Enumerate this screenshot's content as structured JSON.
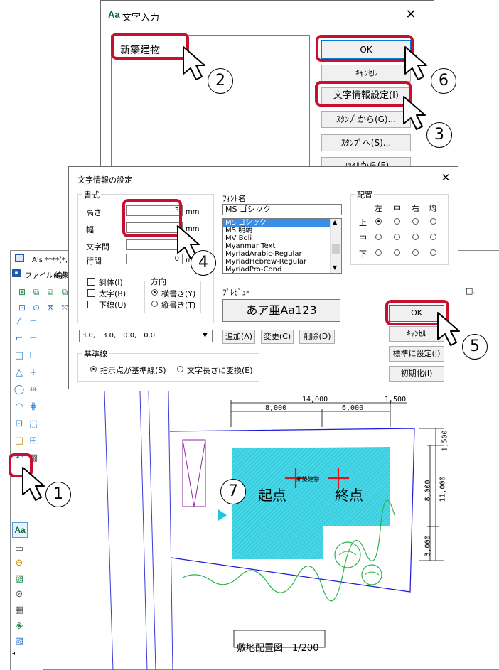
{
  "cad": {
    "title": "A's ****(*,**,***) - 図",
    "menu": [
      "ファイル(F)",
      "編集(E)"
    ],
    "left_tool_text": "Aa",
    "dims": {
      "top_total": "14,000",
      "top_right": "1,500",
      "top_sub_left": "8,000",
      "top_sub_right": "6,000",
      "right_top": "1,500",
      "right_mid": "8,000",
      "right_total": "11,000",
      "right_bottom": "3,000"
    },
    "text_label": "新築建物",
    "start_label": "起点",
    "end_label": "終点",
    "drawing_caption": "敷地配置図　1/200",
    "colors": {
      "building": "#33d1e0",
      "site_line": "#1a1adb",
      "marker": "#e0141b",
      "tree": "#2bb34a",
      "accent_red": "#c8102e"
    }
  },
  "dialog_text_input": {
    "title": "文字入力",
    "icon_text": "Aa",
    "close": "✕",
    "text_value": "新築建物",
    "buttons": {
      "ok": "OK",
      "cancel": "ｷｬﾝｾﾙ",
      "text_info": "文字情報設定(I)",
      "from_stamp": "ｽﾀﾝﾌﾟから(G)...",
      "to_stamp": "ｽﾀﾝﾌﾟへ(S)...",
      "from_file": "ﾌｧｲﾙから(F)"
    }
  },
  "dialog_text_info": {
    "title": "文字情報の設定",
    "close": "✕",
    "format_group": "書式",
    "height_label": "高さ",
    "height_value": "3",
    "width_label": "幅",
    "width_value": "3",
    "char_spacing_label": "文字間",
    "char_spacing_value": "",
    "line_spacing_label": "行間",
    "line_spacing_value": "0",
    "unit": "mm",
    "italic": "斜体(I)",
    "bold": "太字(B)",
    "underline": "下線(U)",
    "direction_group": "方向",
    "horizontal": "横書き(Y)",
    "vertical": "縦書き(T)",
    "font_name_label": "ﾌｫﾝﾄ名",
    "font_name_value": "MS ゴシック",
    "font_list": [
      "MS ゴシック",
      "MS 明朝",
      "MV Boli",
      "Myanmar Text",
      "MyriadArabic-Regular",
      "MyriadHebrew-Regular",
      "MyriadPro-Cond"
    ],
    "preview_label": "ﾌﾟﾚﾋﾞｭｰ",
    "preview_text": "あア亜Aa123",
    "layout_group": "配置",
    "layout_cols": [
      "左",
      "中",
      "右",
      "均"
    ],
    "layout_rows": [
      "上",
      "中",
      "下"
    ],
    "spacing_select": "3.0,　3.0,　0.0,　0.0",
    "add_button": "追加(A)",
    "change_button": "変更(C)",
    "delete_button": "削除(D)",
    "baseline_group": "基準線",
    "baseline_option1": "指示点が基準線(S)",
    "baseline_option2": "文字長さに変換(E)",
    "ok": "OK",
    "cancel": "ｷｬﾝｾﾙ",
    "set_default": "標準に設定(J)",
    "initialize": "初期化(I)"
  },
  "callouts": [
    "1",
    "2",
    "3",
    "4",
    "5",
    "6",
    "7"
  ]
}
